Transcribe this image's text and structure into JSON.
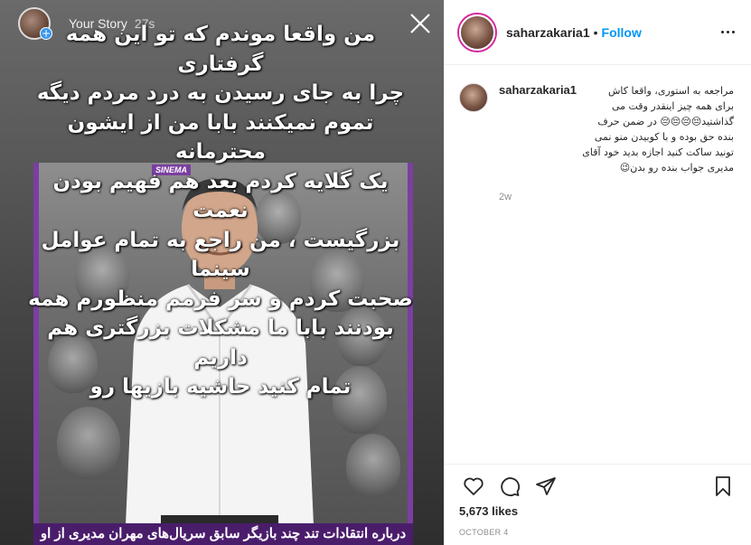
{
  "story": {
    "label": "Your Story",
    "time": "27s",
    "overlay_lines": [
      "من واقعا موندم که تو این همه گرفتاری",
      "چرا به جای رسیدن به درد مردم دیگه",
      "تموم نمیکنند بابا من از ایشون محترمانه",
      "یک گلایه کردم بعد هم فهیم بودن نعمت",
      "بزرگیست ، من راجع به تمام عوامل سینما",
      "صحبت کردم و سر فرمم منظورم همه",
      "بودنند بابا ما مشکلات بزرگتری هم داریم",
      "تمام کنید حاشیه بازیها رو"
    ],
    "poster_tag": "SINEMA",
    "poster_caption": "درباره انتقادات تند چند بازیگر سابق سریال‌های مهران مدیری از او"
  },
  "post": {
    "username": "saharzakaria1",
    "separator": "•",
    "follow_label": "Follow",
    "comment": {
      "username": "saharzakaria1",
      "line1": "مراجعه به استوری، واقعا کاش",
      "rest": "برای همه چیز اینقدر وقت می گذاشتید😔😔😔😔 در ضمن حرف بنده حق بوده و با کوبیدن منو نمی تونید ساکت کنید اجازه بدید خود آقای مدیری جواب بنده رو بدن😉",
      "time": "2w"
    },
    "likes": "5,673 likes",
    "date": "OCTOBER 4"
  },
  "icons": {
    "close": "close-icon",
    "more": "more-options-icon",
    "like": "heart-icon",
    "comment": "comment-icon",
    "share": "share-icon",
    "save": "bookmark-icon"
  },
  "colors": {
    "follow": "#0095f6",
    "poster_border": "#7b3fa0",
    "story_ring": "#d6249f"
  }
}
